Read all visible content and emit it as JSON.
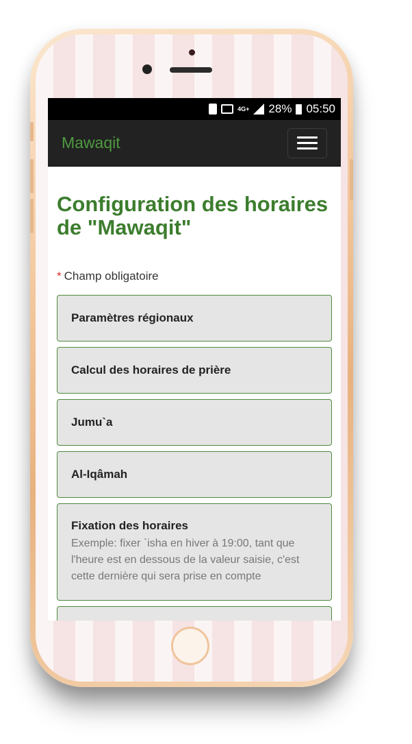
{
  "status_bar": {
    "network": "4G+",
    "battery_percent": "28%",
    "time": "05:50"
  },
  "navbar": {
    "brand": "Mawaqit"
  },
  "page": {
    "title": "Configuration des horaires de \"Mawaqit\"",
    "required_star": "*",
    "required_text": "Champ obligatoire"
  },
  "panels": [
    {
      "title": "Paramètres régionaux"
    },
    {
      "title": "Calcul des horaires de prière"
    },
    {
      "title": "Jumu`a"
    },
    {
      "title": "Al-Iqâmah"
    },
    {
      "title": "Fixation des horaires",
      "description": "Exemple: fixer `isha en hiver à 19:00, tant que l'heure est en dessous de la valeur saisie, c'est cette dernière qui sera prise en compte"
    }
  ],
  "colors": {
    "brand_green": "#4e9a3f",
    "title_green": "#3c7d2e",
    "required_red": "#d9302a",
    "navbar_bg": "#222222"
  }
}
